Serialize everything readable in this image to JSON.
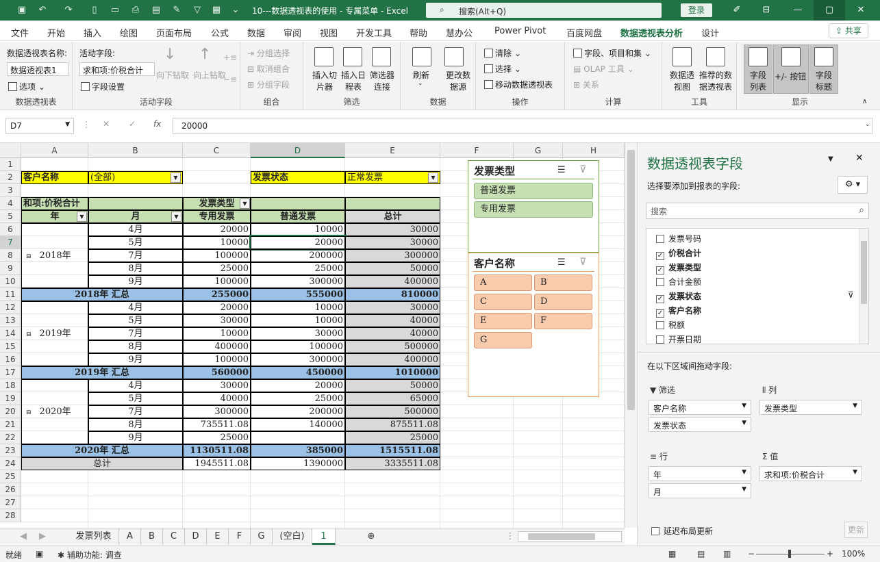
{
  "titlebar": {
    "doc_title": "10---数据透视表的使用 - 专属菜单 - Excel",
    "search_placeholder": "搜索(Alt+Q)",
    "login": "登录"
  },
  "menu": {
    "tabs": [
      "文件",
      "开始",
      "插入",
      "绘图",
      "页面布局",
      "公式",
      "数据",
      "审阅",
      "视图",
      "开发工具",
      "帮助",
      "慧办公",
      "Power Pivot",
      "百度网盘",
      "数据透视表分析",
      "设计"
    ],
    "active_index": 14,
    "share": "共享"
  },
  "ribbon": {
    "pivot": {
      "name_label": "数据透视表名称:",
      "name_value": "数据透视表1",
      "options": "选项",
      "group": "数据透视表"
    },
    "active_field": {
      "label": "活动字段:",
      "value": "求和项:价税合计",
      "settings": "字段设置",
      "drill_down": "向下钻取",
      "drill_up": "向上钻取",
      "group": "活动字段"
    },
    "grouping": {
      "sel": "分组选择",
      "ungroup": "取消组合",
      "field": "分组字段",
      "group": "组合"
    },
    "filter": {
      "slicer": "插入切片器",
      "timeline": "插入日程表",
      "conn": "筛选器连接",
      "group": "筛选"
    },
    "data": {
      "refresh": "刷新",
      "source": "更改数据源",
      "group": "数据"
    },
    "actions": {
      "clear": "清除",
      "select": "选择",
      "move": "移动数据透视表",
      "group": "操作"
    },
    "calc": {
      "fields": "字段、项目和集",
      "olap": "OLAP 工具",
      "rel": "关系",
      "group": "计算"
    },
    "tools": {
      "chart": "数据透视图",
      "recommended": "推荐的数据透视表",
      "group": "工具"
    },
    "show": {
      "field_list": "字段列表",
      "buttons": "+/- 按钮",
      "headers": "字段标题",
      "group": "显示"
    }
  },
  "formula": {
    "namebox": "D7",
    "value": "20000"
  },
  "grid": {
    "columns": [
      "A",
      "B",
      "C",
      "D",
      "E",
      "F",
      "G",
      "H"
    ],
    "rows": [
      "1",
      "2",
      "3",
      "4",
      "5",
      "6",
      "7",
      "8",
      "9",
      "10",
      "11",
      "12",
      "13",
      "14",
      "15",
      "16",
      "17",
      "18",
      "19",
      "20",
      "21",
      "22",
      "23",
      "24",
      "25",
      "26",
      "27",
      "28"
    ],
    "filter1_label": "客户名称",
    "filter1_value": "(全部)",
    "filter2_label": "发票状态",
    "filter2_value": "正常发票",
    "sum_label": "和项:价税合计",
    "col_field": "发票类型",
    "hdr_year": "年",
    "hdr_month": "月",
    "hdr_special": "专用发票",
    "hdr_normal": "普通发票",
    "hdr_total": "总计",
    "years": [
      {
        "year": "2018年",
        "rows": [
          [
            "4月",
            "20000",
            "10000",
            "30000"
          ],
          [
            "5月",
            "10000",
            "20000",
            "30000"
          ],
          [
            "7月",
            "100000",
            "200000",
            "300000"
          ],
          [
            "8月",
            "25000",
            "25000",
            "50000"
          ],
          [
            "9月",
            "100000",
            "300000",
            "400000"
          ]
        ],
        "subtotal": [
          "2018年 汇总",
          "255000",
          "555000",
          "810000"
        ]
      },
      {
        "year": "2019年",
        "rows": [
          [
            "4月",
            "20000",
            "10000",
            "30000"
          ],
          [
            "5月",
            "30000",
            "10000",
            "40000"
          ],
          [
            "7月",
            "10000",
            "30000",
            "40000"
          ],
          [
            "8月",
            "400000",
            "100000",
            "500000"
          ],
          [
            "9月",
            "100000",
            "300000",
            "400000"
          ]
        ],
        "subtotal": [
          "2019年 汇总",
          "560000",
          "450000",
          "1010000"
        ]
      },
      {
        "year": "2020年",
        "rows": [
          [
            "4月",
            "30000",
            "20000",
            "50000"
          ],
          [
            "5月",
            "40000",
            "25000",
            "65000"
          ],
          [
            "7月",
            "300000",
            "200000",
            "500000"
          ],
          [
            "8月",
            "735511.08",
            "140000",
            "875511.08"
          ],
          [
            "9月",
            "25000",
            "",
            "25000"
          ]
        ],
        "subtotal": [
          "2020年 汇总",
          "1130511.08",
          "385000",
          "1515511.08"
        ]
      }
    ],
    "grand": [
      "总计",
      "1945511.08",
      "1390000",
      "3335511.08"
    ]
  },
  "slicer1": {
    "title": "发票类型",
    "items": [
      "普通发票",
      "专用发票"
    ]
  },
  "slicer2": {
    "title": "客户名称",
    "items": [
      "A",
      "B",
      "C",
      "D",
      "E",
      "F",
      "G"
    ]
  },
  "pane": {
    "title": "数据透视表字段",
    "subtitle": "选择要添加到报表的字段:",
    "search_placeholder": "搜索",
    "fields": [
      {
        "name": "发票号码",
        "checked": false
      },
      {
        "name": "价税合计",
        "checked": true
      },
      {
        "name": "发票类型",
        "checked": true
      },
      {
        "name": "合计金额",
        "checked": false
      },
      {
        "name": "发票状态",
        "checked": true
      },
      {
        "name": "客户名称",
        "checked": true
      },
      {
        "name": "税额",
        "checked": false
      },
      {
        "name": "开票日期",
        "checked": false
      }
    ],
    "drag_label": "在以下区域间拖动字段:",
    "filters_label": "筛选",
    "filters": [
      "客户名称",
      "发票状态"
    ],
    "columns_label": "列",
    "columns": [
      "发票类型"
    ],
    "rows_label": "行",
    "rows": [
      "年",
      "月"
    ],
    "values_label": "值",
    "values": [
      "求和项:价税合计"
    ],
    "defer": "延迟布局更新",
    "update": "更新"
  },
  "sheet_tabs": [
    "发票列表",
    "A",
    "B",
    "C",
    "D",
    "E",
    "F",
    "G",
    "(空白)",
    "1"
  ],
  "sheet_active": 9,
  "status": {
    "ready": "就绪",
    "accessibility": "辅助功能: 调查",
    "zoom": "100%"
  },
  "colors": {
    "accent": "#217346",
    "yellow": "#ffff00",
    "green": "#c6e0b4",
    "blue": "#9bc2e6",
    "gray": "#d9d9d9",
    "slicer_green": "#c6e0b4",
    "slicer_orange": "#f8cbad"
  }
}
